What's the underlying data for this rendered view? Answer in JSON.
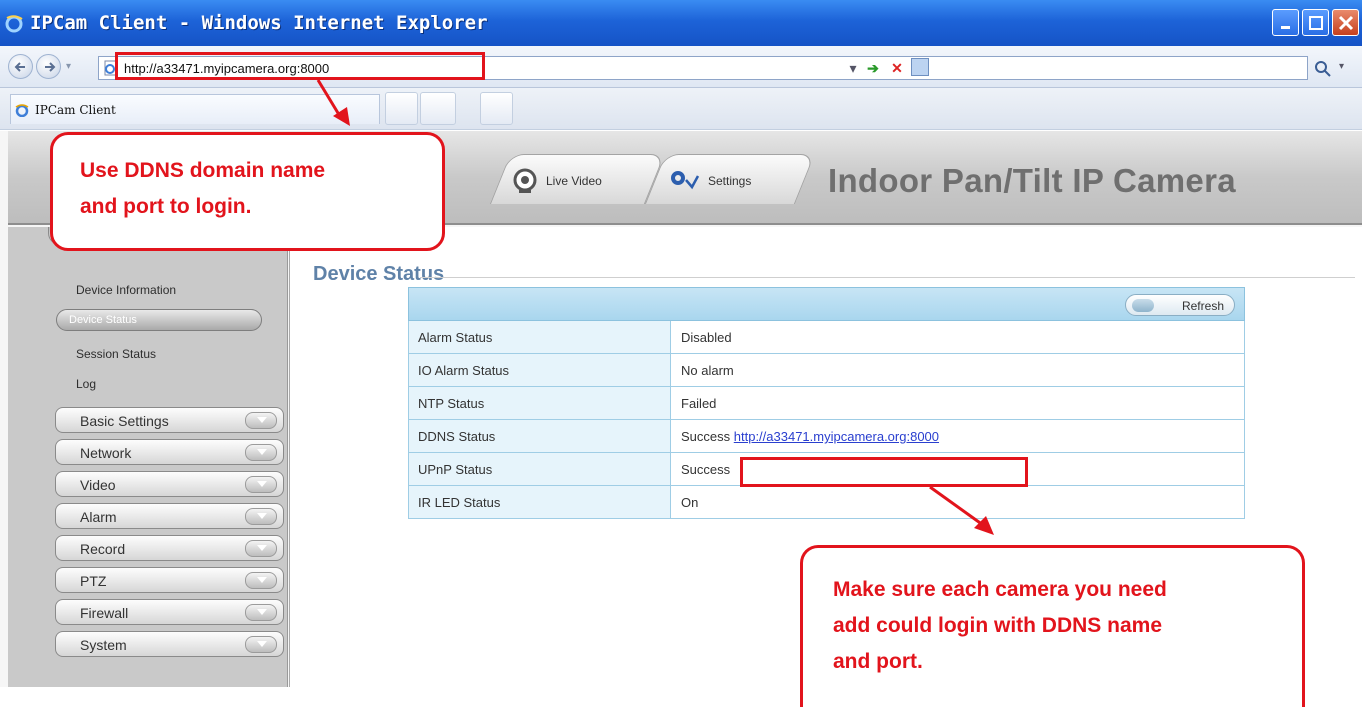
{
  "window": {
    "title": "IPCam Client - Windows Internet Explorer"
  },
  "address_bar": {
    "url": "http://a33471.myipcamera.org:8000"
  },
  "browser_tab": {
    "label": "IPCam Client"
  },
  "camera_header": {
    "tabs": [
      {
        "label": "Live Video",
        "icon": "webcam-icon"
      },
      {
        "label": "Settings",
        "icon": "settings-icon"
      }
    ],
    "product_title": "Indoor Pan/Tilt IP Camera"
  },
  "sidebar": {
    "status_section": {
      "sub_items": [
        "Device Information",
        "Device Status",
        "Session Status",
        "Log"
      ],
      "active_item": "Device Status"
    },
    "menu_items": [
      "Basic Settings",
      "Network",
      "Video",
      "Alarm",
      "Record",
      "PTZ",
      "Firewall",
      "System"
    ]
  },
  "main": {
    "title": "Device Status",
    "refresh_label": "Refresh",
    "rows": [
      {
        "label": "Alarm Status",
        "value": "Disabled"
      },
      {
        "label": "IO Alarm Status",
        "value": "No alarm"
      },
      {
        "label": "NTP Status",
        "value": "Failed"
      },
      {
        "label": "DDNS Status",
        "value": "Success",
        "link": "http://a33471.myipcamera.org:8000"
      },
      {
        "label": "UPnP Status",
        "value": "Success"
      },
      {
        "label": "IR LED Status",
        "value": "On"
      }
    ]
  },
  "annotations": {
    "callout_top": [
      "Use DDNS domain name",
      "and port to login."
    ],
    "callout_bottom": [
      "Make sure each camera you need",
      "add could login with DDNS name",
      "and port."
    ],
    "color": "#e2141c"
  },
  "colors": {
    "title_bar": "#1d63d8",
    "heading_blue": "#5f82a8",
    "table_header": "#a9d6ee",
    "link": "#2a3fcf"
  }
}
